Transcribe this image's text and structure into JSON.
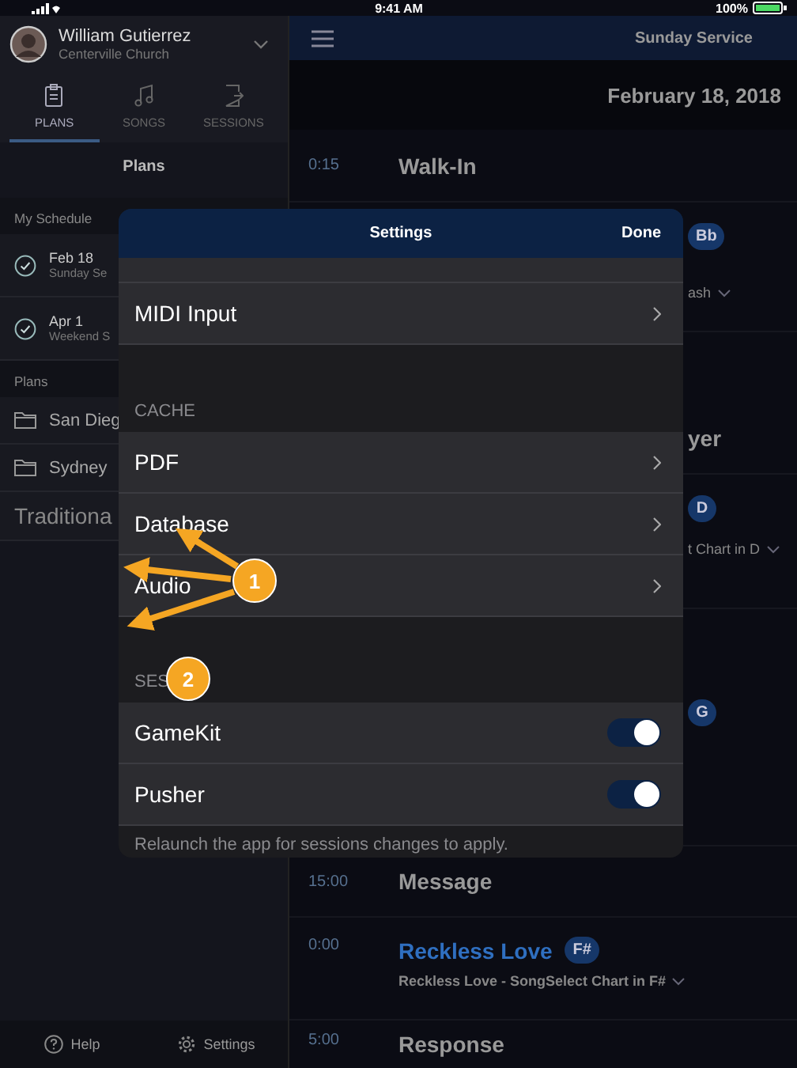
{
  "status_bar": {
    "time": "9:41 AM",
    "battery": "100%"
  },
  "sidebar": {
    "user": {
      "name": "William Gutierrez",
      "church": "Centerville Church"
    },
    "tabs": [
      {
        "label": "PLANS",
        "selected": true
      },
      {
        "label": "SONGS",
        "selected": false
      },
      {
        "label": "SESSIONS",
        "selected": false
      }
    ],
    "title": "Plans",
    "sections": [
      {
        "header": "My Schedule",
        "items": [
          {
            "kind": "scheduled",
            "title": "Feb 18",
            "subtitle": "Sunday Se"
          },
          {
            "kind": "scheduled",
            "title": "Apr 1",
            "subtitle": "Weekend S"
          }
        ]
      },
      {
        "header": "Plans",
        "items": [
          {
            "kind": "folder",
            "title": "San Dieg"
          },
          {
            "kind": "folder",
            "title": "Sydney"
          },
          {
            "kind": "plan",
            "title": "Traditiona"
          }
        ]
      }
    ],
    "footer": [
      {
        "label": "Help"
      },
      {
        "label": "Settings"
      }
    ]
  },
  "main": {
    "title": "Sunday Service",
    "date": "February 18, 2018",
    "items": [
      {
        "kind": "item",
        "time": "0:15",
        "title": "Walk-In"
      },
      {
        "kind": "fragment",
        "badge": "Bb",
        "subtitle": "ash"
      },
      {
        "kind": "fragment",
        "title": "yer"
      },
      {
        "kind": "fragment",
        "badge": "D",
        "subtitle": "t Chart in D"
      },
      {
        "kind": "fragment",
        "badge": "G"
      },
      {
        "kind": "item",
        "time": "15:00",
        "title": "Message"
      },
      {
        "kind": "song",
        "time": "0:00",
        "title": "Reckless Love",
        "badge": "F#",
        "subtitle": "Reckless Love - SongSelect Chart in F#"
      },
      {
        "kind": "item",
        "time": "5:00",
        "title": "Response"
      }
    ]
  },
  "settings": {
    "title": "Settings",
    "done": "Done",
    "groups": [
      {
        "rows": [
          {
            "kind": "cut"
          },
          {
            "kind": "link",
            "label": "MIDI Input"
          }
        ]
      },
      {
        "header": "CACHE",
        "rows": [
          {
            "kind": "link",
            "label": "PDF"
          },
          {
            "kind": "link",
            "label": "Database"
          },
          {
            "kind": "link",
            "label": "Audio"
          }
        ]
      },
      {
        "header": "SES",
        "rows": [
          {
            "kind": "toggle",
            "label": "GameKit",
            "on": true
          },
          {
            "kind": "toggle",
            "label": "Pusher",
            "on": true
          }
        ],
        "note": "Relaunch the app for sessions changes to apply."
      }
    ]
  },
  "annotations": [
    {
      "number": "1"
    },
    {
      "number": "2"
    }
  ]
}
